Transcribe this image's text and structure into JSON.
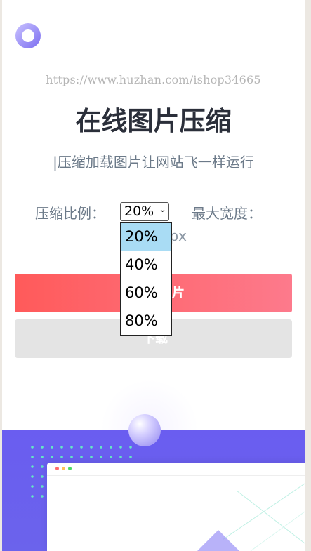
{
  "watermark": "https://www.huzhan.com/ishop34665",
  "title": "在线图片压缩",
  "subtitle": "|压缩加载图片让网站飞一样运行",
  "form": {
    "ratio_label": "压缩比例：",
    "ratio_selected": "20%",
    "ratio_options": [
      "20%",
      "40%",
      "60%",
      "80%"
    ],
    "max_width_label": "最大宽度：",
    "width_unit": "px"
  },
  "buttons": {
    "primary_visible_text": "片",
    "secondary_visible_text": "下载"
  },
  "colors": {
    "primary_start": "#ff5a5a",
    "primary_end": "#fd7a8c",
    "hero_purple": "#6a5df0",
    "option_highlight": "#a9dcf4"
  },
  "icons": {
    "logo": "ring-logo-icon",
    "select_arrow": "chevron-down-icon"
  }
}
